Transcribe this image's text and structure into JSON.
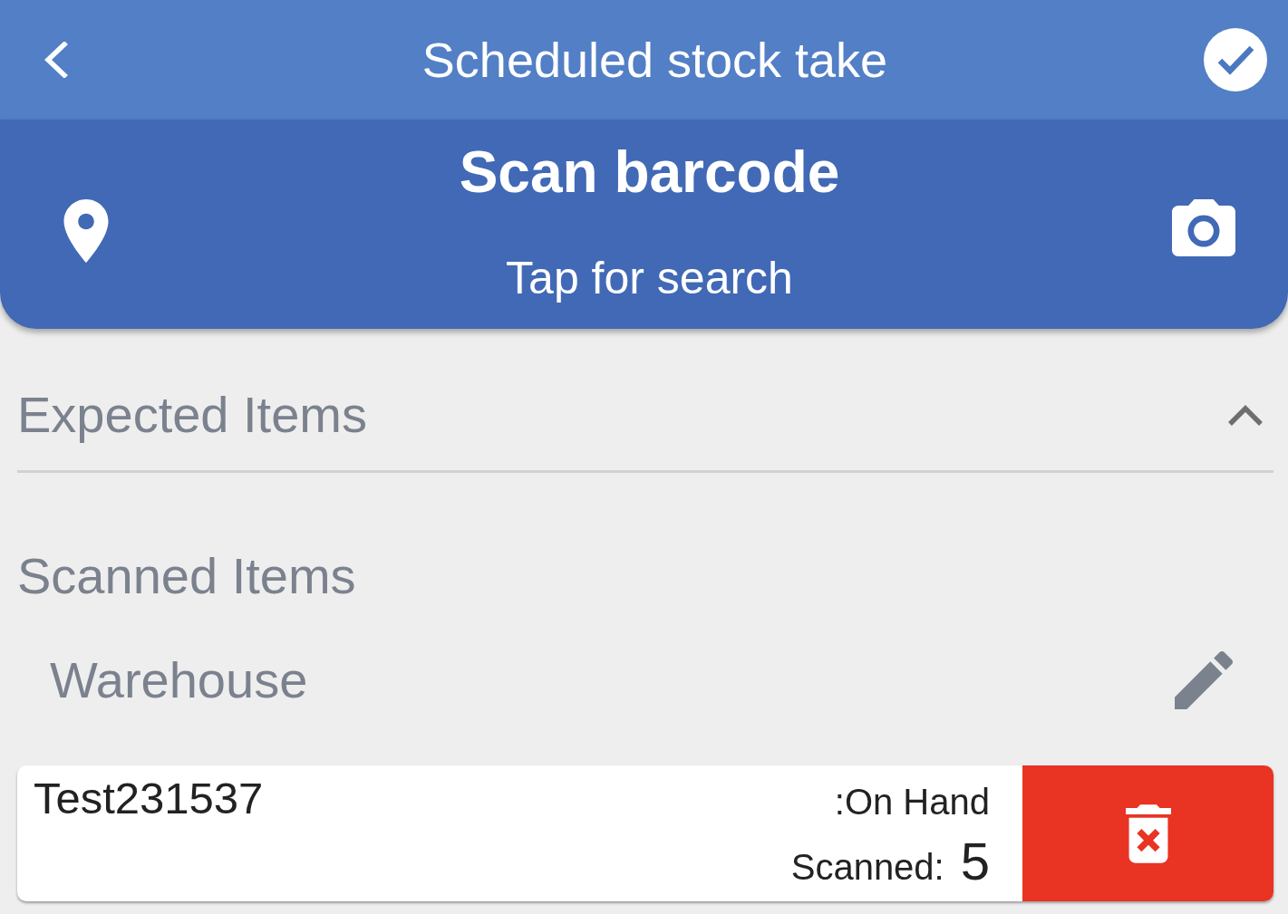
{
  "app_bar": {
    "title": "Scheduled stock take"
  },
  "scan_panel": {
    "title": "Scan barcode",
    "subtitle": "Tap for search"
  },
  "expected_items": {
    "title": "Expected Items",
    "expanded": true
  },
  "scanned_items": {
    "title": "Scanned Items",
    "locations": [
      {
        "name": "Warehouse",
        "items": [
          {
            "code": "Test231537",
            "on_hand_label": ":On Hand",
            "scanned_label": "Scanned:",
            "scanned_count": "5"
          }
        ]
      }
    ]
  }
}
